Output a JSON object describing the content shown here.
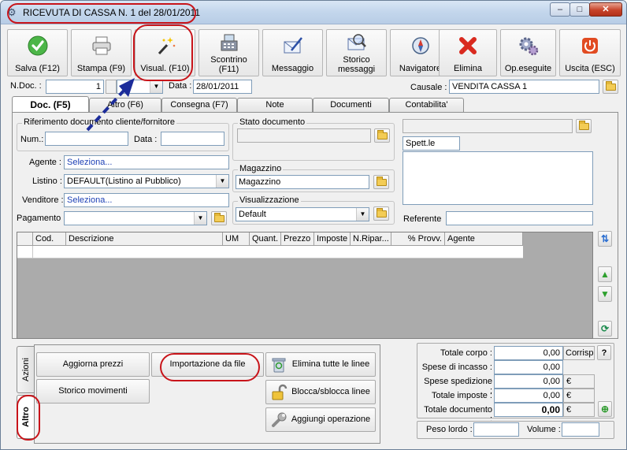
{
  "window": {
    "title": "RICEVUTA DI CASSA N. 1  del 28/01/2011",
    "minimize": "–",
    "maximize": "□",
    "close": "✕"
  },
  "toolbar": {
    "buttons": [
      {
        "label": "Salva (F12)",
        "icon": "check-icon"
      },
      {
        "label": "Stampa (F9)",
        "icon": "printer-icon"
      },
      {
        "label": "Visual. (F10)",
        "icon": "magic-wand-icon"
      },
      {
        "label": "Scontrino\n(F11)",
        "icon": "cash-register-icon"
      },
      {
        "label": "Messaggio",
        "icon": "envelope-pen-icon"
      },
      {
        "label": "Storico\nmessaggi",
        "icon": "envelope-search-icon"
      },
      {
        "label": "Navigatore",
        "icon": "compass-icon"
      },
      {
        "label": "Elimina",
        "icon": "red-x-icon"
      },
      {
        "label": "Op.eseguite",
        "icon": "gears-icon"
      },
      {
        "label": "Uscita (ESC)",
        "icon": "power-icon"
      }
    ]
  },
  "header": {
    "ndoc_label": "N.Doc. :",
    "ndoc_value": "1",
    "data_label": "Data :",
    "data_value": "28/01/2011",
    "causale_label": "Causale :",
    "causale_value": "VENDITA CASSA 1"
  },
  "tabs": [
    "Doc. (F5)",
    "Altro (F6)",
    "Consegna (F7)",
    "Note",
    "Documenti",
    "Contabilita'"
  ],
  "doc": {
    "rif_group": "Riferimento documento cliente/fornitore",
    "num_label": "Num.:",
    "data_label": "Data :",
    "stato_group": "Stato documento",
    "agente_label": "Agente :",
    "agente_value": "Seleziona...",
    "listino_label": "Listino :",
    "listino_value": "DEFAULT(Listino al Pubblico)",
    "venditore_label": "Venditore :",
    "venditore_value": "Seleziona...",
    "pagamento_label": "Pagamento :",
    "magazzino_group": "Magazzino",
    "magazzino_value": "Magazzino",
    "visual_group": "Visualizzazione",
    "visual_value": "Default",
    "spett_value": "Spett.le",
    "referente_label": "Referente"
  },
  "grid": {
    "columns": [
      "Cod.",
      "Descrizione",
      "UM",
      "Quant.",
      "Prezzo",
      "Imposte",
      "N.Ripar...",
      "% Provv.",
      "Agente"
    ]
  },
  "side_tabs": [
    "Azioni",
    "Altro"
  ],
  "actions": {
    "aggiorna_prezzi": "Aggiorna prezzi",
    "importazione": "Importazione da file",
    "storico_movimenti": "Storico movimenti",
    "elimina_linee": "Elimina tutte le linee",
    "blocca_linee": "Blocca/sblocca linee",
    "aggiungi_operazione": "Aggiungi operazione"
  },
  "totals": {
    "corpo_label": "Totale corpo :",
    "corpo_value": "0,00",
    "corrisp": "Corrisp.",
    "help": "?",
    "incasso_label": "Spese di incasso :",
    "incasso_value": "0,00",
    "spedizione_label": "Spese spedizione :",
    "spedizione_value": "0,00",
    "imposte_label": "Totale imposte :",
    "imposte_value": "0,00",
    "documento_label": "Totale documento :",
    "documento_value": "0,00",
    "currency": "€",
    "peso_label": "Peso lordo :",
    "volume_label": "Volume :"
  }
}
